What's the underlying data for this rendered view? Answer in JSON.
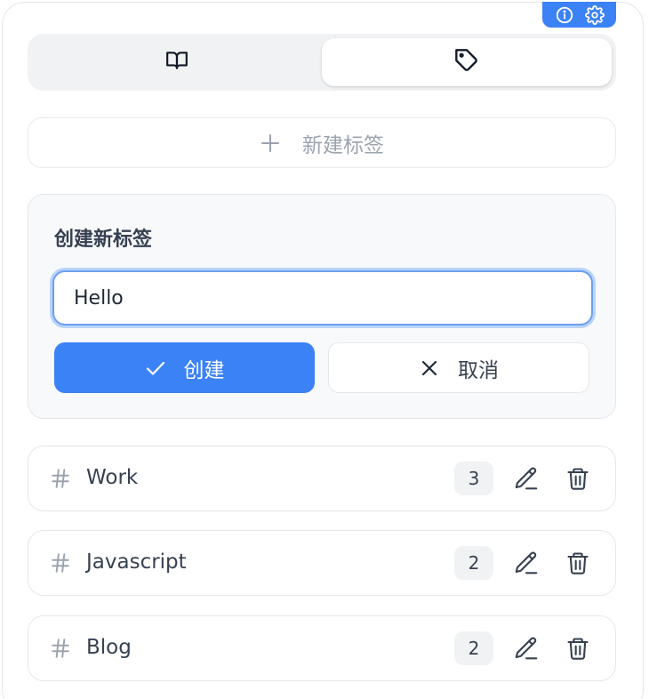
{
  "badge": {
    "icons": [
      "info-icon",
      "gear-icon"
    ],
    "color": "#3b82f6"
  },
  "tabs": [
    {
      "icon": "book-icon",
      "active": false
    },
    {
      "icon": "tag-icon",
      "active": true
    }
  ],
  "new_tag_button": {
    "label": "新建标签",
    "icon": "plus-icon"
  },
  "create_form": {
    "title": "创建新标签",
    "input_value": "Hello",
    "create_label": "创建",
    "cancel_label": "取消"
  },
  "tags": [
    {
      "name": "Work",
      "count": "3"
    },
    {
      "name": "Javascript",
      "count": "2"
    },
    {
      "name": "Blog",
      "count": "2"
    }
  ],
  "colors": {
    "accent": "#3b82f6",
    "muted": "#9ca3af",
    "text": "#374151"
  }
}
